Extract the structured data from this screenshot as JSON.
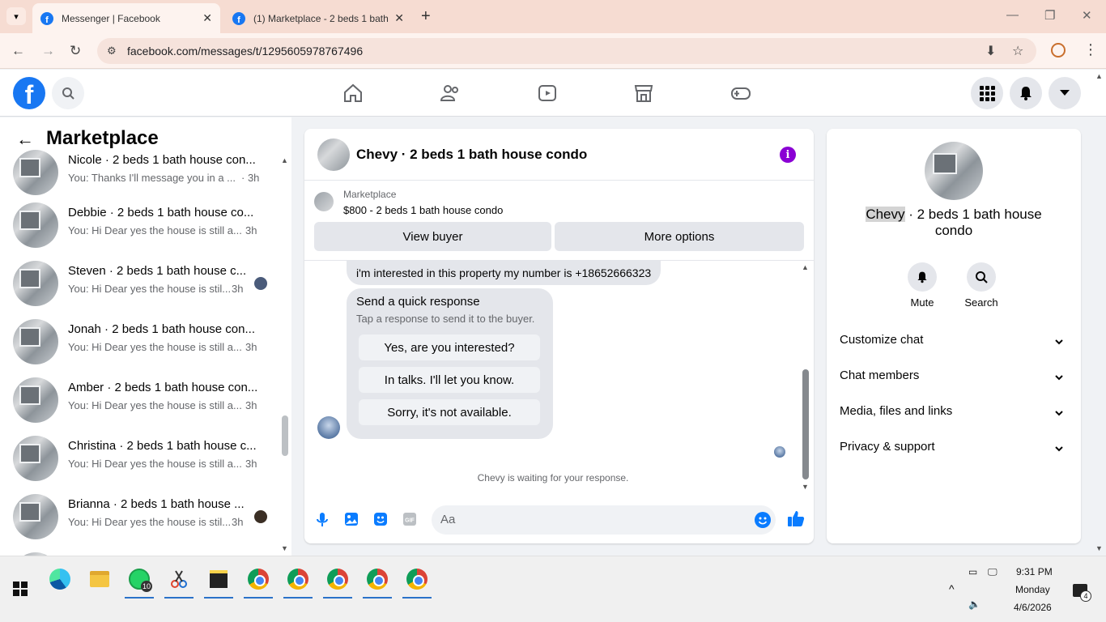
{
  "browser": {
    "tabs": [
      {
        "title": "Messenger | Facebook",
        "active": true
      },
      {
        "title": "(1) Marketplace - 2 beds 1 bath",
        "active": false
      }
    ],
    "url": "facebook.com/messages/t/1295605978767496"
  },
  "left_panel": {
    "title": "Marketplace",
    "conversations": [
      {
        "name": "Nicole · 2 beds 1 bath house con...",
        "preview": "You: Thanks I'll message you in a ...",
        "time": "· 3h",
        "seen": false
      },
      {
        "name": "Debbie · 2 beds 1 bath house co...",
        "preview": "You: Hi Dear yes the house is still a...",
        "time": "3h",
        "seen": false
      },
      {
        "name": "Steven · 2 beds 1 bath house c...",
        "preview": "You: Hi Dear yes the house is stil...",
        "time": "3h",
        "seen": true
      },
      {
        "name": "Jonah · 2 beds 1 bath house con...",
        "preview": "You: Hi Dear yes the house is still a...",
        "time": "3h",
        "seen": false
      },
      {
        "name": "Amber · 2 beds 1 bath house con...",
        "preview": "You: Hi Dear yes the house is still a...",
        "time": "3h",
        "seen": false
      },
      {
        "name": "Christina · 2 beds 1 bath house c...",
        "preview": "You: Hi Dear yes the house is still a...",
        "time": "3h",
        "seen": false
      },
      {
        "name": "Brianna · 2 beds 1 bath house ...",
        "preview": "You: Hi Dear yes the house is stil...",
        "time": "3h",
        "seen": true
      }
    ]
  },
  "chat": {
    "title": "Chevy · 2 beds 1 bath house condo",
    "listing_label": "Marketplace",
    "listing_price_title": "$800 - 2 beds 1 bath house condo",
    "view_buyer": "View buyer",
    "more_options": "More options",
    "message": "i'm interested in this property my number is +18652666323",
    "quick_response_title": "Send a quick response",
    "quick_response_sub": "Tap a response to send it to the buyer.",
    "quick_responses": [
      "Yes, are you interested?",
      "In talks. I'll let you know.",
      "Sorry, it's not available."
    ],
    "waiting": "Chevy is waiting for your response.",
    "composer_placeholder": "Aa"
  },
  "right_panel": {
    "name_highlight": "Chevy",
    "name_rest": " · 2 beds 1 bath house condo",
    "mute": "Mute",
    "search": "Search",
    "sections": [
      "Customize chat",
      "Chat members",
      "Media, files and links",
      "Privacy & support"
    ]
  },
  "taskbar": {
    "whatsapp_badge": "10",
    "time": "9:31 PM",
    "day": "Monday",
    "date": "4/6/2026",
    "notifications": "4"
  },
  "colors": {
    "fb_blue": "#1877f2",
    "messenger_blue": "#0a7cff",
    "info_purple": "#8a00d4",
    "chrome_tab_bar": "#f6dcd2"
  }
}
